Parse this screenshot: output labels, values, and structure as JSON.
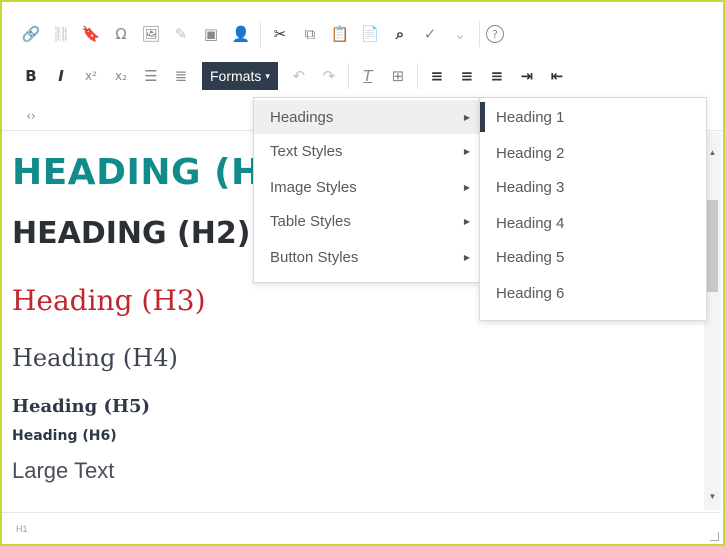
{
  "toolbar": {
    "row1": [
      {
        "icon": "link-icon",
        "glyph": "🔗"
      },
      {
        "icon": "unlink-icon",
        "glyph": "⛓"
      },
      {
        "icon": "bookmark-icon",
        "glyph": "🔖"
      },
      {
        "icon": "omega-icon",
        "glyph": "Ω"
      },
      {
        "icon": "image-icon",
        "glyph": "🖼"
      },
      {
        "icon": "edit-image-icon",
        "glyph": "✎"
      },
      {
        "icon": "media-icon",
        "glyph": "▣"
      },
      {
        "icon": "user-icon",
        "glyph": "👤"
      },
      {
        "icon": "cut-icon",
        "glyph": "✂"
      },
      {
        "icon": "copy-icon",
        "glyph": "⧉"
      },
      {
        "icon": "paste-icon",
        "glyph": "📋"
      },
      {
        "icon": "paste-text-icon",
        "glyph": "📄"
      },
      {
        "icon": "find-icon",
        "glyph": "⌕"
      },
      {
        "icon": "spellcheck-icon",
        "glyph": "✓"
      },
      {
        "icon": "help-icon",
        "glyph": "?"
      }
    ],
    "row2": [
      {
        "icon": "bold-icon",
        "glyph": "B"
      },
      {
        "icon": "italic-icon",
        "glyph": "I"
      },
      {
        "icon": "superscript-icon",
        "glyph": "x²"
      },
      {
        "icon": "subscript-icon",
        "glyph": "x₂"
      },
      {
        "icon": "bullet-list-icon",
        "glyph": "☰"
      },
      {
        "icon": "numbered-list-icon",
        "glyph": "≣"
      }
    ],
    "formats_label": "Formats",
    "row2b": [
      {
        "icon": "undo-icon",
        "glyph": "↶"
      },
      {
        "icon": "redo-icon",
        "glyph": "↷"
      },
      {
        "icon": "clear-format-icon",
        "glyph": "T"
      },
      {
        "icon": "table-icon",
        "glyph": "⊞"
      },
      {
        "icon": "align-left-icon",
        "glyph": "≡"
      },
      {
        "icon": "align-center-icon",
        "glyph": "≡"
      },
      {
        "icon": "align-right-icon",
        "glyph": "≡"
      },
      {
        "icon": "indent-icon",
        "glyph": "⇥"
      },
      {
        "icon": "outdent-icon",
        "glyph": "⇤"
      }
    ],
    "row3": [
      {
        "icon": "code-icon",
        "glyph": "‹›"
      }
    ]
  },
  "content": {
    "h1": "HEADING (H1)",
    "h2": "HEADING (H2)",
    "h3": "Heading (H3)",
    "h4": "Heading (H4)",
    "h5": "Heading (H5)",
    "h6": "Heading (H6)",
    "large": "Large Text"
  },
  "formats_menu": {
    "items": [
      "Headings",
      "Text Styles",
      "Image Styles",
      "Table Styles",
      "Button Styles"
    ],
    "active": "Headings"
  },
  "headings_submenu": {
    "items": [
      "Heading 1",
      "Heading 2",
      "Heading 3",
      "Heading 4",
      "Heading 5",
      "Heading 6"
    ]
  },
  "statusbar": {
    "path": "H1"
  },
  "colors": {
    "border": "#c8d63a",
    "formats_bg": "#2f3c4b",
    "h1": "#118b8c",
    "h3": "#c0262d"
  }
}
